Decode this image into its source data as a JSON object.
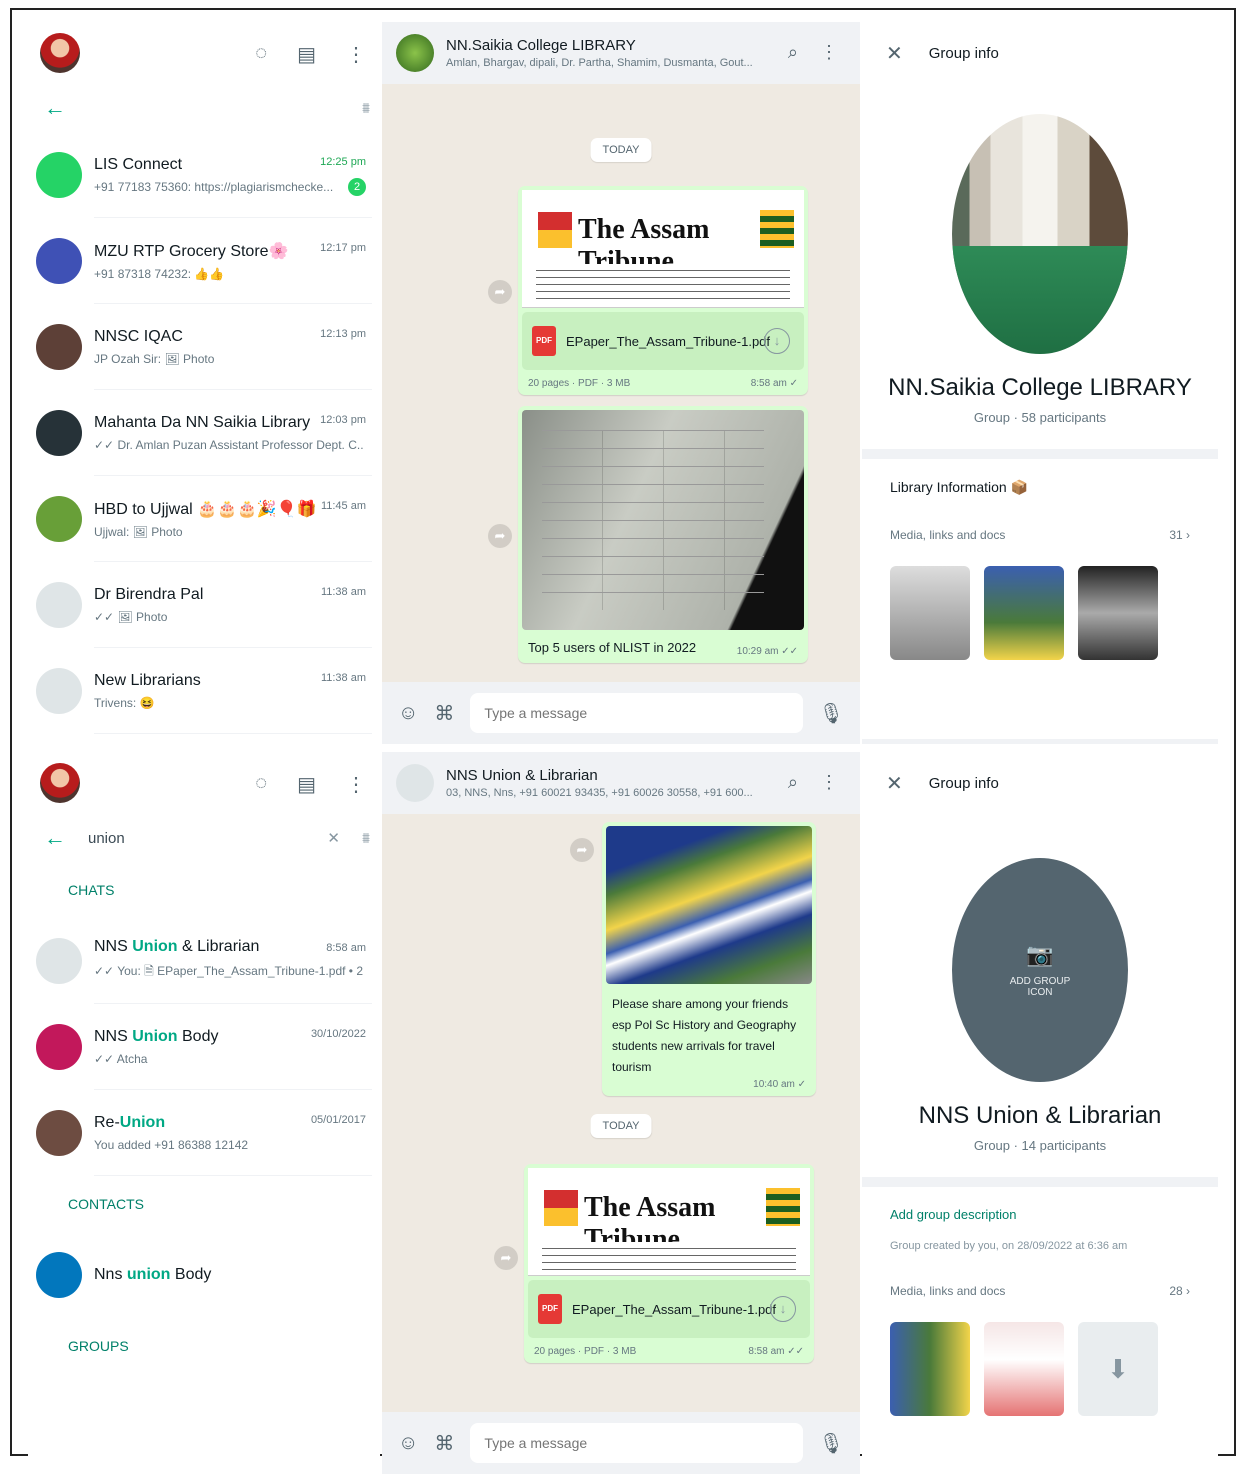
{
  "screen1": {
    "left": {
      "chats": [
        {
          "name": "LIS Connect",
          "preview": "+91 77183 75360: https://plagiarismchecke...",
          "time": "12:25 pm",
          "time_green": true,
          "badge": "2",
          "avatar": "#25d366"
        },
        {
          "name": "MZU RTP Grocery Store🌸",
          "preview": "+91 87318 74232: 👍👍",
          "time": "12:17 pm",
          "avatar": "#3f51b5"
        },
        {
          "name": "NNSC IQAC",
          "preview": "JP Ozah Sir: 🖼 Photo",
          "time": "12:13 pm",
          "avatar": "#5d4037"
        },
        {
          "name": "Mahanta Da NN Saikia Library",
          "preview": "✓✓ Dr. Amlan Puzan Assistant Professor Dept. C...",
          "time": "12:03 pm",
          "avatar": "#263238"
        },
        {
          "name": "HBD to Ujjwal 🎂🎂🎂🎉🎈🎁",
          "preview": "Ujjwal: 🖼 Photo",
          "time": "11:45 am",
          "avatar": "#689f38"
        },
        {
          "name": "Dr Birendra Pal",
          "preview": "✓✓ 🖼 Photo",
          "time": "11:38 am",
          "avatar": "#dfe5e7"
        },
        {
          "name": "New Librarians",
          "preview": "Trivens: 😆",
          "time": "11:38 am",
          "avatar": "#dfe5e7"
        }
      ]
    },
    "mid": {
      "title": "NN.Saikia College LIBRARY",
      "subtitle": "Amlan, Bhargav, dipali, Dr. Partha, Shamim, Dusmanta, Gout...",
      "day": "TODAY",
      "masthead": "The Assam Tribune",
      "file_name": "EPaper_The_Assam_Tribune-1.pdf",
      "file_meta": "20 pages · PDF · 3 MB",
      "file_time": "8:58 am ✓",
      "caption": "Top 5 users of NLIST in 2022",
      "caption_time": "10:29 am ✓✓",
      "compose_placeholder": "Type a message"
    },
    "right": {
      "header": "Group info",
      "group_name": "NN.Saikia College LIBRARY",
      "group_sub": "Group · 58 participants",
      "description": "Library Information 📦",
      "media_label": "Media, links and docs",
      "media_count": "31 ›"
    }
  },
  "screen2": {
    "left": {
      "search_value": "union",
      "chats_label": "CHATS",
      "contacts_label": "CONTACTS",
      "groups_label": "GROUPS",
      "results": [
        {
          "pre": "NNS ",
          "hl": "Union",
          "post": " & Librarian",
          "preview": "✓✓ You: 🗎 EPaper_The_Assam_Tribune-1.pdf • 2...",
          "time": "8:58 am",
          "avatar": "#dfe5e7"
        },
        {
          "pre": "NNS ",
          "hl": "Union",
          "post": " Body",
          "preview": "✓✓ Atcha",
          "time": "30/10/2022",
          "avatar": "#c2185b"
        },
        {
          "pre": "Re-",
          "hl": "Union",
          "post": "",
          "preview": "You added +91 86388 12142",
          "time": "05/01/2017",
          "avatar": "#6d4c41"
        }
      ],
      "contact": {
        "pre": "Nns ",
        "hl": "union",
        "post": " Body",
        "avatar": "#0277bd"
      }
    },
    "mid": {
      "title": "NNS Union & Librarian",
      "subtitle": "03, NNS, Nns, +91 60021 93435, +91 60026 30558, +91 600...",
      "caption": "Please share among your friends esp Pol Sc History and Geography students new arrivals for travel tourism",
      "caption_time": "10:40 am ✓",
      "day": "TODAY",
      "masthead": "The Assam Tribune",
      "file_name": "EPaper_The_Assam_Tribune-1.pdf",
      "file_meta": "20 pages · PDF · 3 MB",
      "file_time": "8:58 am ✓✓",
      "compose_placeholder": "Type a message"
    },
    "right": {
      "header": "Group info",
      "add_icon_line1": "ADD GROUP",
      "add_icon_line2": "ICON",
      "group_name": "NNS Union & Librarian",
      "group_sub": "Group · 14 participants",
      "add_desc": "Add group description",
      "created": "Group created by you, on 28/09/2022 at 6:36 am",
      "media_label": "Media, links and docs",
      "media_count": "28 ›"
    }
  }
}
